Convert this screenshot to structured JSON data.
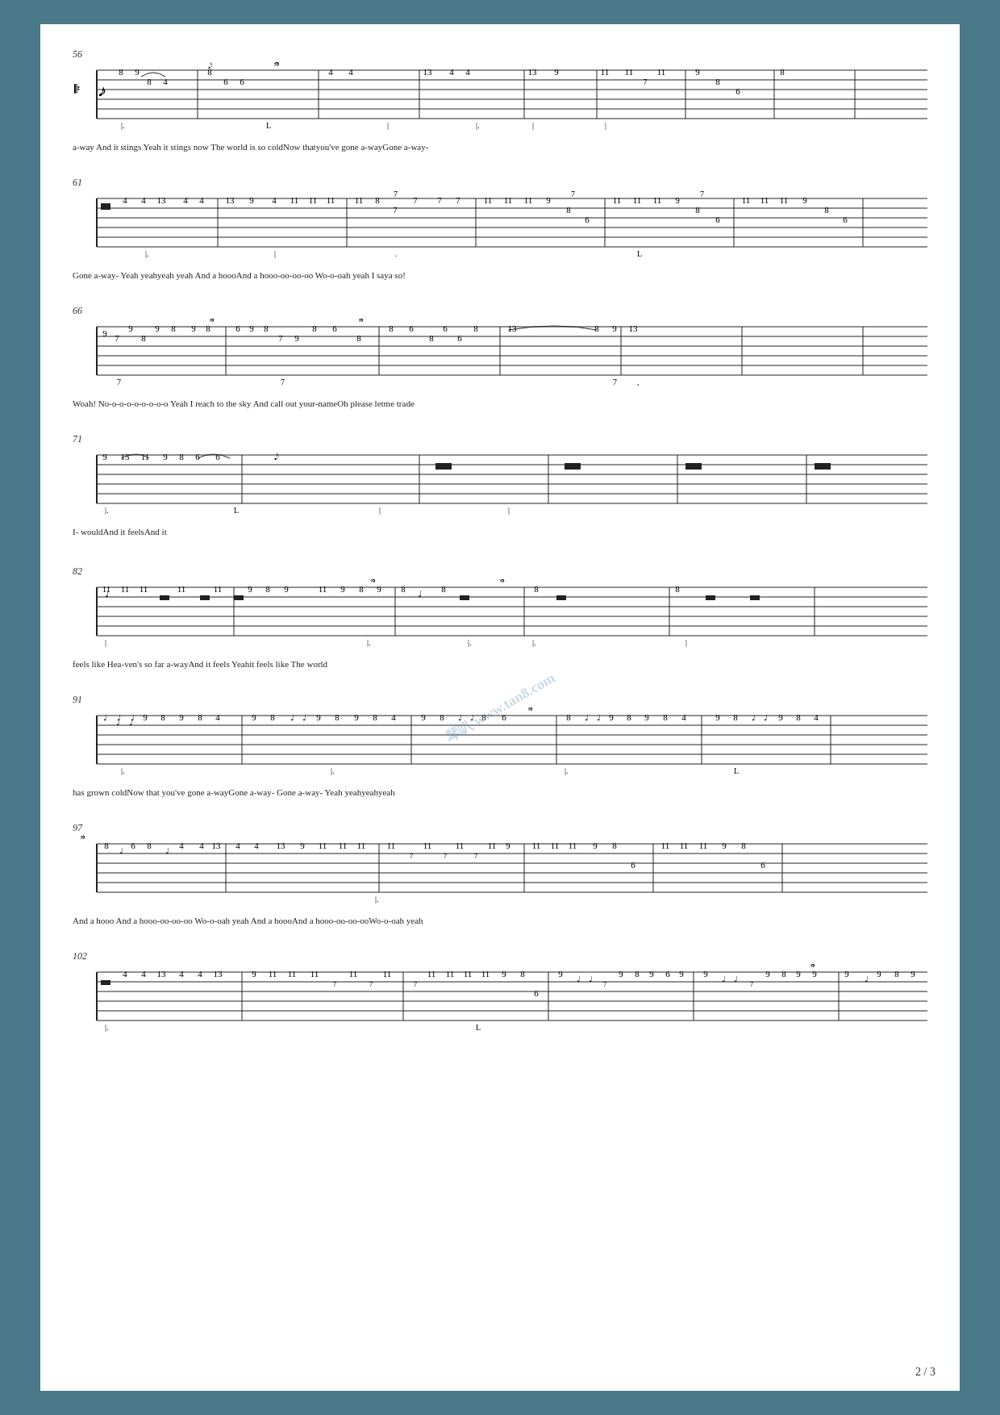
{
  "page": {
    "background": "#4a7a8a",
    "sheet_bg": "#ffffff",
    "page_number": "2 / 3",
    "watermark": "琴叭 www.tan8.com"
  },
  "sections": [
    {
      "id": "sec56",
      "measure_start": 56,
      "lyrics": "a-way And it  stings        Yeah it stings       now The   world is so   coldNow   thatyou've gone  a-wayGone a-way-"
    },
    {
      "id": "sec61",
      "measure_start": 61,
      "lyrics": "Gone a-way-  Yeah yeahyeah  yeah And a    hoooAnd a    hooo-oo-oo-oo    Wo-o-oah yeah I    saya so!"
    },
    {
      "id": "sec66",
      "measure_start": 66,
      "lyrics": "Woah! No-o-o-o-o-o-o-o-o Yeah  I     reach to the  sky  And call    out  your-nameOh please      letme trade"
    },
    {
      "id": "sec71",
      "measure_start": 71,
      "lyrics": "I-  wouldAnd      it feelsAnd it"
    },
    {
      "id": "sec82",
      "measure_start": 82,
      "lyrics": "feels like Hea-ven's  so      far      a-wayAnd it  feels   Yeahit feels like  The      world"
    },
    {
      "id": "sec91",
      "measure_start": 91,
      "lyrics": "has grown  coldNow that          you've gone   a-wayGone a-way-  Gone   a-way-  Yeah  yeahyeahyeah"
    },
    {
      "id": "sec97",
      "measure_start": 97,
      "lyrics": "And a  hooo       And a    hooo-oo-oo-oo Wo-o-oah yeah  And a   hoooAnd a   hooo-oo-oo-ooWo-o-oah yeah"
    },
    {
      "id": "sec102",
      "measure_start": 102,
      "lyrics": ""
    }
  ]
}
